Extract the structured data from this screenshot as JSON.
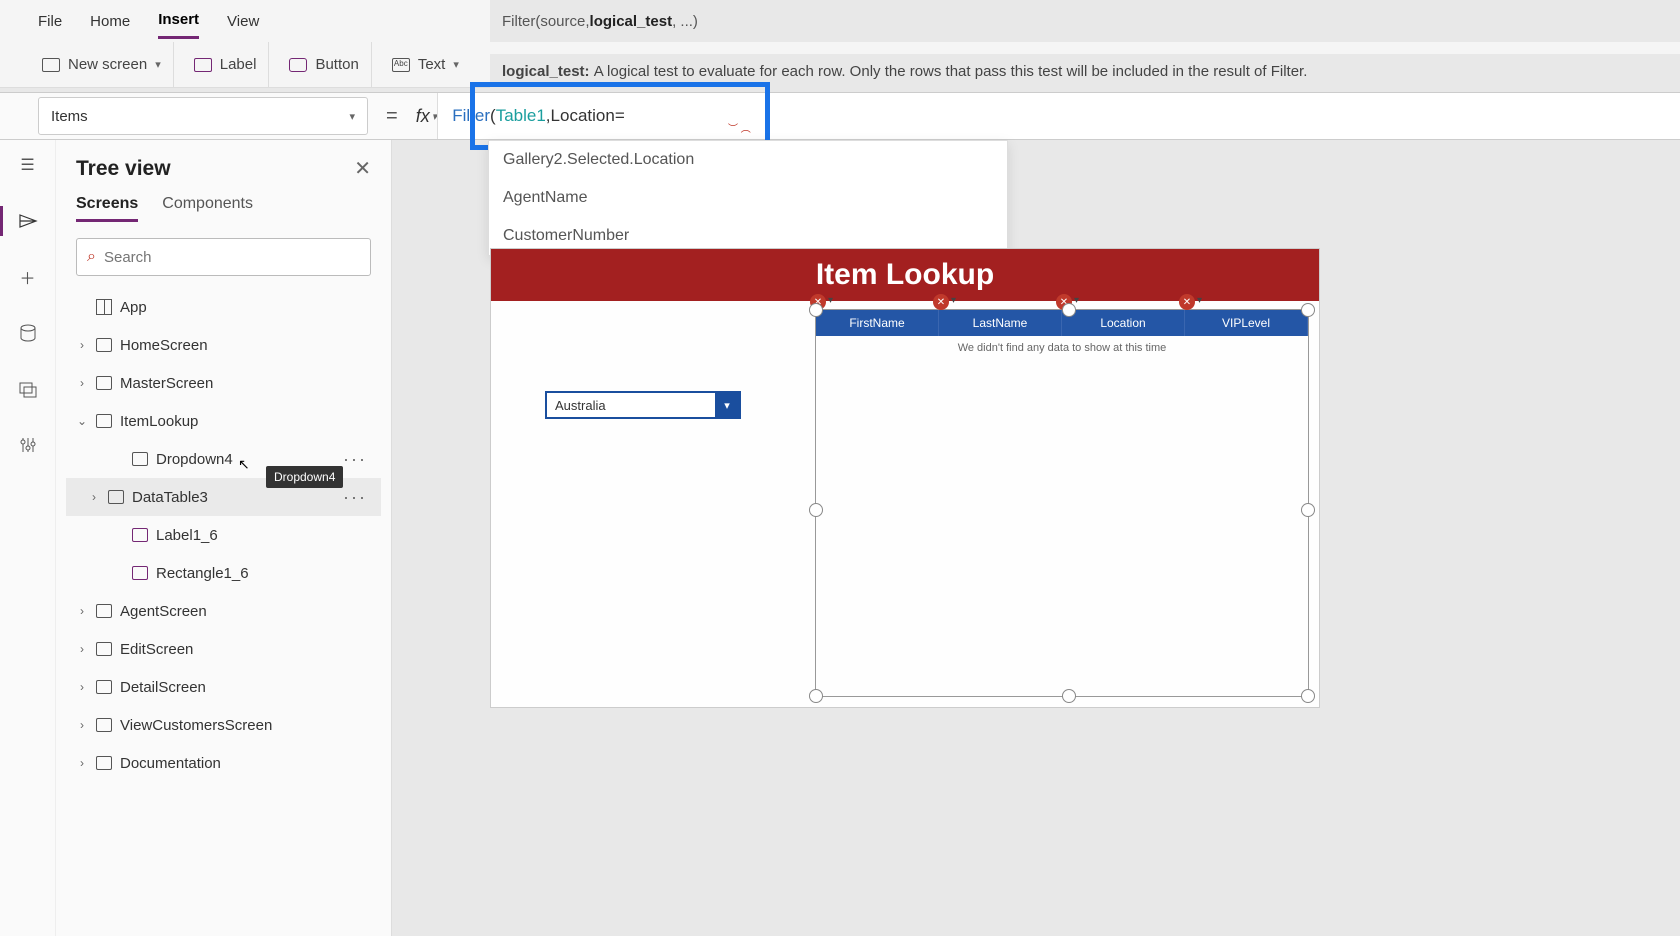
{
  "menubar": {
    "file": "File",
    "home": "Home",
    "insert": "Insert",
    "view": "View"
  },
  "ribbon": {
    "new_screen": "New screen",
    "label": "Label",
    "button": "Button",
    "text": "Text"
  },
  "signature": {
    "fn": "Filter",
    "rest": "(source, ",
    "bold": "logical_test",
    "tail": ", ...)"
  },
  "description": {
    "label": "logical_test:",
    "text": "A logical test to evaluate for each row. Only the rows that pass this test will be included in the result of Filter."
  },
  "property_selector": "Items",
  "fx_label": "fx",
  "formula": {
    "fn": "Filter",
    "open": "(",
    "table": "Table1",
    "comma": ", ",
    "field": "Location",
    "op": " ="
  },
  "intellisense": [
    "Gallery2.Selected.Location",
    "AgentName",
    "CustomerNumber"
  ],
  "tree": {
    "title": "Tree view",
    "tab_screens": "Screens",
    "tab_components": "Components",
    "search_placeholder": "Search",
    "items": {
      "app": "App",
      "home": "HomeScreen",
      "master": "MasterScreen",
      "itemlookup": "ItemLookup",
      "dropdown4": "Dropdown4",
      "datatable3": "DataTable3",
      "label1_6": "Label1_6",
      "rectangle1_6": "Rectangle1_6",
      "agent": "AgentScreen",
      "edit": "EditScreen",
      "detail": "DetailScreen",
      "viewcust": "ViewCustomersScreen",
      "doc": "Documentation"
    },
    "tooltip": "Dropdown4"
  },
  "canvas": {
    "title": "Item Lookup",
    "dropdown_value": "Australia",
    "columns": [
      "FirstName",
      "LastName",
      "Location",
      "VIPLevel"
    ],
    "empty": "We didn't find any data to show at this time"
  }
}
